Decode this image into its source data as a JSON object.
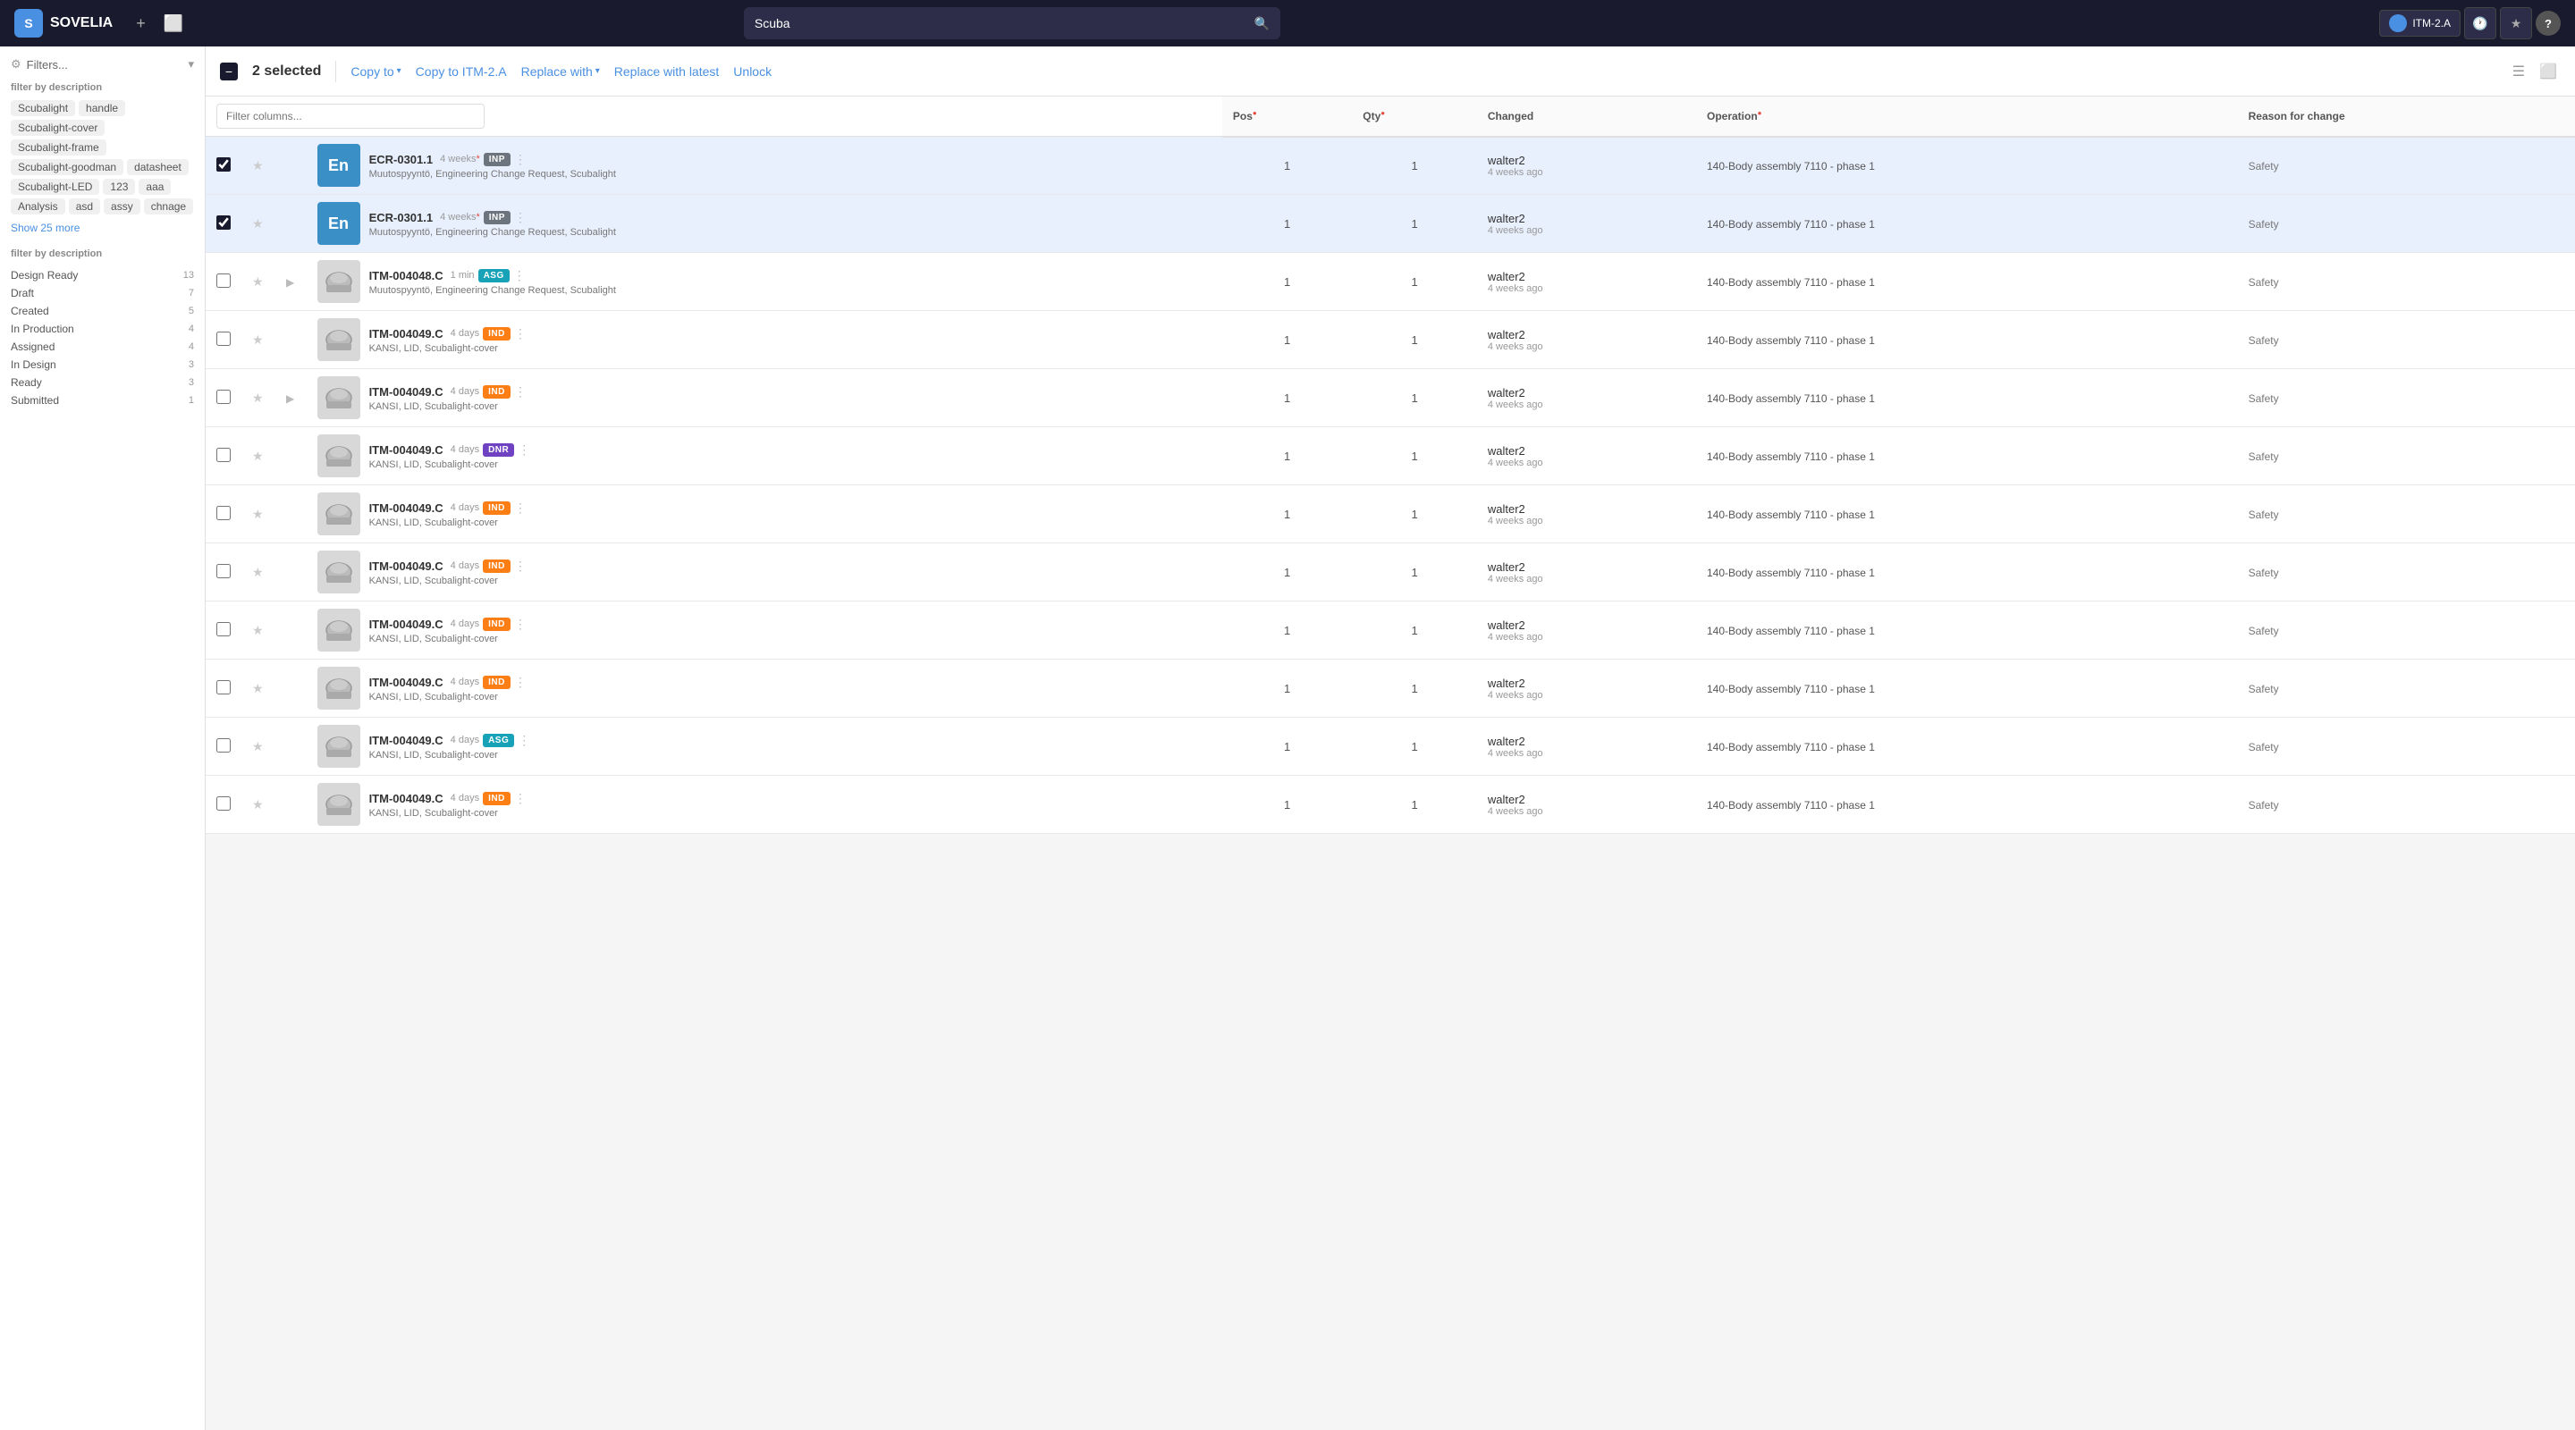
{
  "app": {
    "name": "SOVELIA",
    "logo_letter": "S"
  },
  "topnav": {
    "add_btn": "+",
    "window_btn": "⬜",
    "search_placeholder": "Scuba",
    "itm_label": "ITM-2.A",
    "help_label": "?"
  },
  "sidebar": {
    "filters_label": "Filters...",
    "filter_by_description_label": "Filter by description",
    "tags": [
      "Scubalight",
      "handle",
      "Scubalight-cover",
      "Scubalight-frame",
      "Scubalight-goodman",
      "datasheet",
      "Scubalight-LED",
      "123",
      "aaa",
      "Analysis",
      "asd",
      "assy",
      "chnage"
    ],
    "show_more_label": "Show 25 more",
    "filter_by_status_label": "Filter by description",
    "status_items": [
      {
        "label": "Design Ready",
        "count": 13
      },
      {
        "label": "Draft",
        "count": 7
      },
      {
        "label": "Created",
        "count": 5
      },
      {
        "label": "In Production",
        "count": 4
      },
      {
        "label": "Assigned",
        "count": 4
      },
      {
        "label": "In Design",
        "count": 3
      },
      {
        "label": "Ready",
        "count": 3
      },
      {
        "label": "Submitted",
        "count": 1
      }
    ]
  },
  "toolbar": {
    "selected_count": "2 selected",
    "copy_to_label": "Copy to",
    "copy_to_itm_label": "Copy to ITM-2.A",
    "replace_with_label": "Replace with",
    "replace_with_latest_label": "Replace with latest",
    "unlock_label": "Unlock"
  },
  "table": {
    "filter_placeholder": "Filter columns...",
    "columns": [
      {
        "label": "Pos",
        "sortable": true,
        "has_dot": true
      },
      {
        "label": "Qty",
        "sortable": true,
        "has_dot": true
      },
      {
        "label": "Changed",
        "sortable": false,
        "has_dot": false
      },
      {
        "label": "Operation",
        "sortable": false,
        "has_dot": true
      },
      {
        "label": "Reason for change",
        "sortable": false,
        "has_dot": false
      }
    ],
    "rows": [
      {
        "selected": true,
        "starred": false,
        "has_expand": false,
        "thumb_type": "en",
        "code": "ECR-0301.1",
        "time": "4 weeks",
        "asterisk": true,
        "desc": "Muutospyyntö, Engineering Change Request, Scubalight",
        "badge": "INP",
        "badge_class": "badge-inp",
        "pos": 1,
        "qty": 1,
        "changed_user": "walter2",
        "changed_time": "4 weeks ago",
        "operation": "140-Body assembly 7110 - phase 1",
        "reason": "Safety"
      },
      {
        "selected": true,
        "starred": false,
        "has_expand": false,
        "thumb_type": "en",
        "code": "ECR-0301.1",
        "time": "4 weeks",
        "asterisk": true,
        "desc": "Muutospyyntö, Engineering Change Request, Scubalight",
        "badge": "INP",
        "badge_class": "badge-inp",
        "pos": 1,
        "qty": 1,
        "changed_user": "walter2",
        "changed_time": "4 weeks ago",
        "operation": "140-Body assembly 7110 - phase 1",
        "reason": "Safety"
      },
      {
        "selected": false,
        "starred": false,
        "has_expand": true,
        "thumb_type": "img",
        "code": "ITM-004048.C",
        "time": "1 min",
        "asterisk": false,
        "desc": "Muutospyyntö, Engineering Change Request, Scubalight",
        "badge": "ASG",
        "badge_class": "badge-asg",
        "pos": 1,
        "qty": 1,
        "changed_user": "walter2",
        "changed_time": "4 weeks ago",
        "operation": "140-Body assembly 7110 - phase 1",
        "reason": "Safety"
      },
      {
        "selected": false,
        "starred": false,
        "has_expand": false,
        "thumb_type": "img",
        "code": "ITM-004049.C",
        "time": "4 days",
        "asterisk": false,
        "desc": "KANSI, LID, Scubalight-cover",
        "badge": "IND",
        "badge_class": "badge-ind",
        "pos": 1,
        "qty": 1,
        "changed_user": "walter2",
        "changed_time": "4 weeks ago",
        "operation": "140-Body assembly 7110 - phase 1",
        "reason": "Safety"
      },
      {
        "selected": false,
        "starred": false,
        "has_expand": true,
        "thumb_type": "img",
        "code": "ITM-004049.C",
        "time": "4 days",
        "asterisk": false,
        "desc": "KANSI, LID, Scubalight-cover",
        "badge": "IND",
        "badge_class": "badge-ind",
        "pos": 1,
        "qty": 1,
        "changed_user": "walter2",
        "changed_time": "4 weeks ago",
        "operation": "140-Body assembly 7110 - phase 1",
        "reason": "Safety"
      },
      {
        "selected": false,
        "starred": false,
        "has_expand": false,
        "thumb_type": "img",
        "code": "ITM-004049.C",
        "time": "4 days",
        "asterisk": false,
        "desc": "KANSI, LID, Scubalight-cover",
        "badge": "DNR",
        "badge_class": "badge-dnr",
        "pos": 1,
        "qty": 1,
        "changed_user": "walter2",
        "changed_time": "4 weeks ago",
        "operation": "140-Body assembly 7110 - phase 1",
        "reason": "Safety"
      },
      {
        "selected": false,
        "starred": false,
        "has_expand": false,
        "thumb_type": "img",
        "code": "ITM-004049.C",
        "time": "4 days",
        "asterisk": false,
        "desc": "KANSI, LID, Scubalight-cover",
        "badge": "IND",
        "badge_class": "badge-ind",
        "pos": 1,
        "qty": 1,
        "changed_user": "walter2",
        "changed_time": "4 weeks ago",
        "operation": "140-Body assembly 7110 - phase 1",
        "reason": "Safety"
      },
      {
        "selected": false,
        "starred": false,
        "has_expand": false,
        "thumb_type": "img",
        "code": "ITM-004049.C",
        "time": "4 days",
        "asterisk": false,
        "desc": "KANSI, LID, Scubalight-cover",
        "badge": "IND",
        "badge_class": "badge-ind",
        "pos": 1,
        "qty": 1,
        "changed_user": "walter2",
        "changed_time": "4 weeks ago",
        "operation": "140-Body assembly 7110 - phase 1",
        "reason": "Safety"
      },
      {
        "selected": false,
        "starred": false,
        "has_expand": false,
        "thumb_type": "img",
        "code": "ITM-004049.C",
        "time": "4 days",
        "asterisk": false,
        "desc": "KANSI, LID, Scubalight-cover",
        "badge": "IND",
        "badge_class": "badge-ind",
        "pos": 1,
        "qty": 1,
        "changed_user": "walter2",
        "changed_time": "4 weeks ago",
        "operation": "140-Body assembly 7110 - phase 1",
        "reason": "Safety"
      },
      {
        "selected": false,
        "starred": false,
        "has_expand": false,
        "thumb_type": "img",
        "code": "ITM-004049.C",
        "time": "4 days",
        "asterisk": false,
        "desc": "KANSI, LID, Scubalight-cover",
        "badge": "IND",
        "badge_class": "badge-ind",
        "pos": 1,
        "qty": 1,
        "changed_user": "walter2",
        "changed_time": "4 weeks ago",
        "operation": "140-Body assembly 7110 - phase 1",
        "reason": "Safety"
      },
      {
        "selected": false,
        "starred": false,
        "has_expand": false,
        "thumb_type": "img",
        "code": "ITM-004049.C",
        "time": "4 days",
        "asterisk": false,
        "desc": "KANSI, LID, Scubalight-cover",
        "badge": "ASG",
        "badge_class": "badge-asg",
        "pos": 1,
        "qty": 1,
        "changed_user": "walter2",
        "changed_time": "4 weeks ago",
        "operation": "140-Body assembly 7110 - phase 1",
        "reason": "Safety"
      },
      {
        "selected": false,
        "starred": false,
        "has_expand": false,
        "thumb_type": "img",
        "code": "ITM-004049.C",
        "time": "4 days",
        "asterisk": false,
        "desc": "KANSI, LID, Scubalight-cover",
        "badge": "IND",
        "badge_class": "badge-ind",
        "pos": 1,
        "qty": 1,
        "changed_user": "walter2",
        "changed_time": "4 weeks ago",
        "operation": "140-Body assembly 7110 - phase 1",
        "reason": "Safety"
      }
    ]
  }
}
